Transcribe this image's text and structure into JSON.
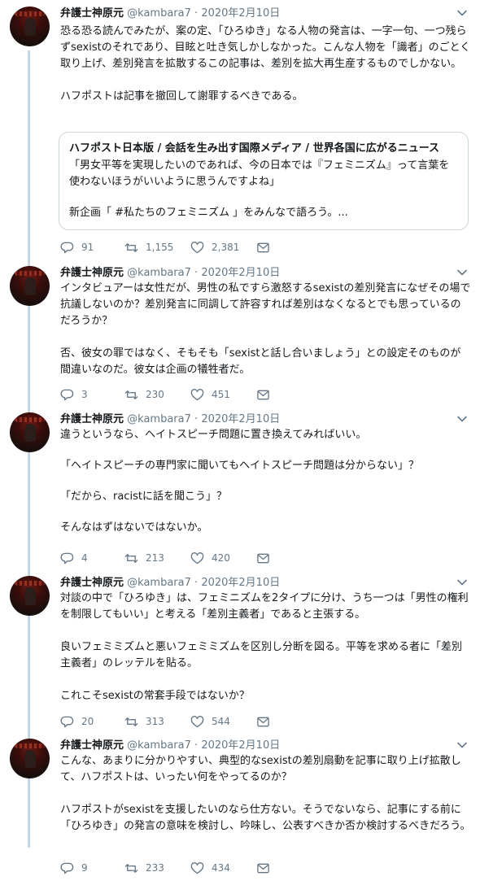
{
  "tweets": [
    {
      "name": "弁護士神原元",
      "handle": "@kambara7",
      "separator": "·",
      "date": "2020年2月10日",
      "paragraphs": [
        "恐る恐る読んでみたが、案の定、「ひろゆき」なる人物の発言は、一字一句、一つ残らずsexistのそれであり、目眩と吐き気しかしなかった。こんな人物を「識者」のごとく取り上げ、差別発言を拡散するこの記事は、差別を拡大再生産するものでしかない。",
        "ハフポストは記事を撤回して謝罪するべきである。"
      ],
      "card": {
        "title": "ハフポスト日本版 / 会話を生み出す国際メディア / 世界各国に広がるニュース",
        "paragraphs": [
          "「男女平等を実現したいのであれば、今の日本では『フェミニズム』って言葉を使わないほうがいいように思うんですよね」",
          "新企画「 #私たちのフェミニズム 」をみんなで語ろう。..."
        ]
      },
      "replies": "91",
      "retweets": "1,155",
      "likes": "2,381"
    },
    {
      "name": "弁護士神原元",
      "handle": "@kambara7",
      "separator": "·",
      "date": "2020年2月10日",
      "paragraphs": [
        "インタビュアーは女性だが、男性の私ですら激怒するsexistの差別発言になぜその場で抗議しないのか？差別発言に同調して許容すれば差別はなくなるとでも思っているのだろうか？",
        "否、彼女の罪ではなく、そもそも「sexistと話し合いましょう」との設定そのものが間違いなのだ。彼女は企画の犠牲者だ。"
      ],
      "replies": "3",
      "retweets": "230",
      "likes": "451"
    },
    {
      "name": "弁護士神原元",
      "handle": "@kambara7",
      "separator": "·",
      "date": "2020年2月10日",
      "paragraphs": [
        "違うというなら、ヘイトスピーチ問題に置き換えてみればいい。",
        "「ヘイトスピーチの専門家に聞いてもヘイトスピーチ問題は分からない」？",
        "「だから、racistに話を聞こう」？",
        "そんなはずはないではないか。"
      ],
      "replies": "4",
      "retweets": "213",
      "likes": "420"
    },
    {
      "name": "弁護士神原元",
      "handle": "@kambara7",
      "separator": "·",
      "date": "2020年2月10日",
      "paragraphs": [
        "対談の中で「ひろゆき」は、フェミニズムを2タイプに分け、うち一つは「男性の権利を制限してもいい」と考える「差別主義者」であると主張する。",
        "良いフェミミズムと悪いフェミミズムを区別し分断を図る。平等を求める者に「差別主義者」のレッテルを貼る。",
        "これこそsexistの常套手段ではないか？"
      ],
      "replies": "20",
      "retweets": "313",
      "likes": "544"
    },
    {
      "name": "弁護士神原元",
      "handle": "@kambara7",
      "separator": "·",
      "date": "2020年2月10日",
      "paragraphs": [
        "こんな、あまりに分かりやすい、典型的なsexistの差別扇動を記事に取り上げ拡散して、ハフポストは、いったい何をやってるのか？",
        "ハフポストがsexistを支援したいのなら仕方ない。そうでないなら、記事にする前に「ひろゆき」の発言の意味を検討し、吟味し、公表すべきか否か検討するべきだろう。"
      ],
      "replies": "9",
      "retweets": "233",
      "likes": "434"
    }
  ],
  "colors": {
    "text": "#14171a",
    "secondary": "#657786",
    "thread_line": "#c4d6e4",
    "card_border": "#ccd6dd"
  }
}
